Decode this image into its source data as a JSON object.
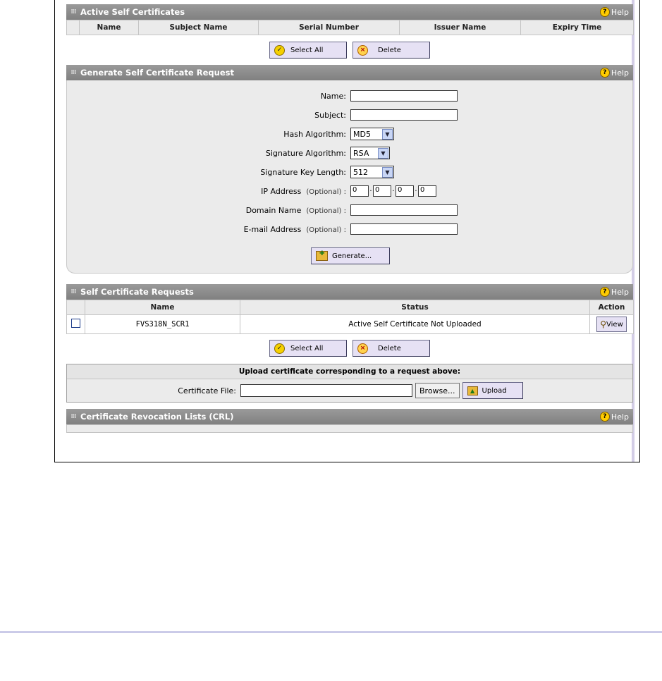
{
  "active": {
    "title": "Active Self Certificates",
    "help": "Help",
    "columns": [
      "Name",
      "Subject Name",
      "Serial Number",
      "Issuer Name",
      "Expiry Time"
    ],
    "select_all": "Select All",
    "delete": "Delete"
  },
  "generate": {
    "title": "Generate Self Certificate Request",
    "help": "Help",
    "name_label": "Name:",
    "subject_label": "Subject:",
    "hash_label": "Hash Algorithm:",
    "hash_value": "MD5",
    "sig_label": "Signature Algorithm:",
    "sig_value": "RSA",
    "keylen_label": "Signature Key Length:",
    "keylen_value": "512",
    "ip_label": "IP Address",
    "ip_optional": "(Optional) :",
    "ip_values": [
      "0",
      "0",
      "0",
      "0"
    ],
    "domain_label": "Domain Name",
    "domain_optional": "(Optional) :",
    "email_label": "E-mail Address",
    "email_optional": "(Optional) :",
    "generate_button": "Generate..."
  },
  "requests": {
    "title": "Self Certificate Requests",
    "help": "Help",
    "columns": [
      "Name",
      "Status",
      "Action"
    ],
    "rows": [
      {
        "name": "FVS318N_SCR1",
        "status": "Active Self Certificate Not Uploaded",
        "action": "View"
      }
    ],
    "select_all": "Select All",
    "delete": "Delete"
  },
  "upload": {
    "title": "Upload certificate corresponding to a request above:",
    "file_label": "Certificate File:",
    "browse": "Browse...",
    "upload_button": "Upload"
  },
  "crl": {
    "title": "Certificate Revocation Lists (CRL)",
    "help": "Help"
  }
}
